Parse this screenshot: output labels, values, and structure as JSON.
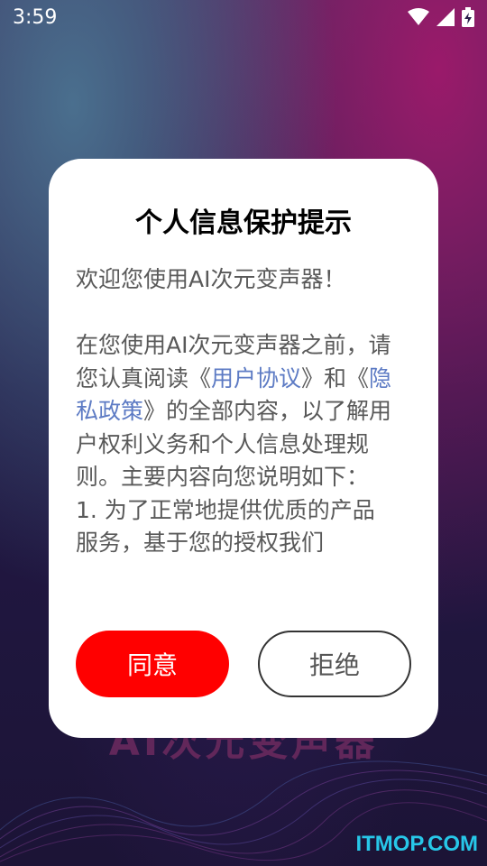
{
  "status_bar": {
    "time": "3:59",
    "icons": [
      "wifi-icon",
      "signal-icon",
      "battery-charging-icon"
    ]
  },
  "background": {
    "app_title": "AI次元变声器"
  },
  "dialog": {
    "title": "个人信息保护提示",
    "welcome": "欢迎您使用AI次元变声器！",
    "body": {
      "p1_before": "在您使用AI次元变声器之前，请您认真阅读《",
      "link_user_agreement": "用户协议",
      "and_text": "》和《",
      "link_privacy_policy": "隐私政策",
      "p1_after": "》的全部内容，以了解用户权利义务和个人信息处理规则。主要内容向您说明如下：",
      "item1": "1. 为了正常地提供优质的产品服务，基于您的授权我们"
    },
    "agree_label": "同意",
    "reject_label": "拒绝"
  },
  "watermark": "ITMOP.COM",
  "colors": {
    "agree_button": "#ff0000",
    "link": "#5d7bc4",
    "watermark": "#27c7e8"
  }
}
